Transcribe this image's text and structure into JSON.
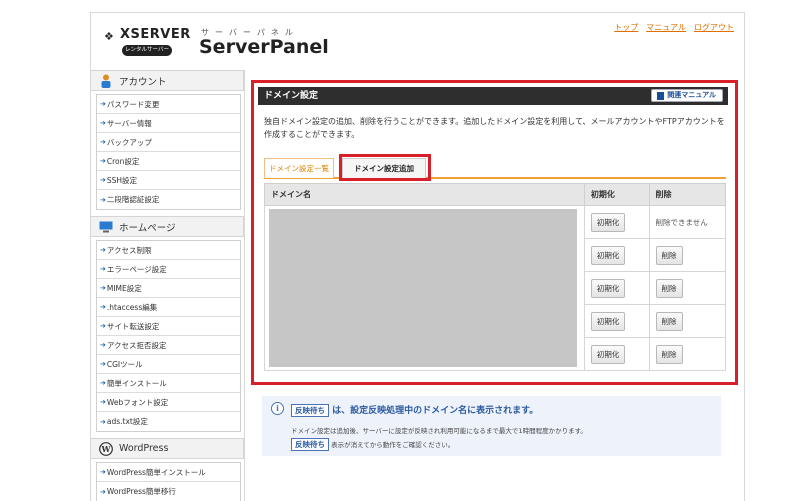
{
  "header": {
    "brand": "XSERVER",
    "brand_sub": "レンタルサーバー",
    "kana": "サーバーパネル",
    "product": "ServerPanel",
    "links": [
      "トップ",
      "マニュアル",
      "ログアウト"
    ]
  },
  "sidebar": {
    "sections": [
      {
        "title": "アカウント",
        "icon": "person-icon",
        "items": [
          "パスワード変更",
          "サーバー情報",
          "バックアップ",
          "Cron設定",
          "SSH設定",
          "二段階認証設定"
        ]
      },
      {
        "title": "ホームページ",
        "icon": "monitor-icon",
        "items": [
          "アクセス制限",
          "エラーページ設定",
          "MIME設定",
          ".htaccess編集",
          "サイト転送設定",
          "アクセス拒否設定",
          "CGIツール",
          "簡単インストール",
          "Webフォント設定",
          "ads.txt設定"
        ]
      },
      {
        "title": "WordPress",
        "icon": "wordpress-icon",
        "items": [
          "WordPress簡単インストール",
          "WordPress簡単移行"
        ]
      }
    ]
  },
  "panel": {
    "title": "ドメイン設定",
    "manual_button": "関連マニュアル",
    "description": "独自ドメイン設定の追加、削除を行うことができます。追加したドメイン設定を利用して、メールアカウントやFTPアカウントを作成することができます。",
    "tabs": [
      "ドメイン設定一覧",
      "ドメイン設定追加"
    ],
    "table": {
      "headers": [
        "ドメイン名",
        "初期化",
        "削除"
      ],
      "rows": [
        {
          "init": "初期化",
          "delete": "削除できません"
        },
        {
          "init": "初期化",
          "delete": "削除"
        },
        {
          "init": "初期化",
          "delete": "削除"
        },
        {
          "init": "初期化",
          "delete": "削除"
        },
        {
          "init": "初期化",
          "delete": "削除"
        }
      ]
    }
  },
  "notice": {
    "badge": "反映待ち",
    "headline": "は、設定反映処理中のドメイン名に表示されます。",
    "line2": "ドメイン設定は追加後、サーバーに設定が反映され利用可能になるまで最大で1時間程度かかります。",
    "line3_badge": "反映待ち",
    "line3": "表示が消えてから動作をご確認ください。"
  },
  "colors": {
    "accent": "#d81f2a",
    "tab_active": "#e08000",
    "link": "#e07000",
    "header_dark": "#2e2e2e"
  }
}
